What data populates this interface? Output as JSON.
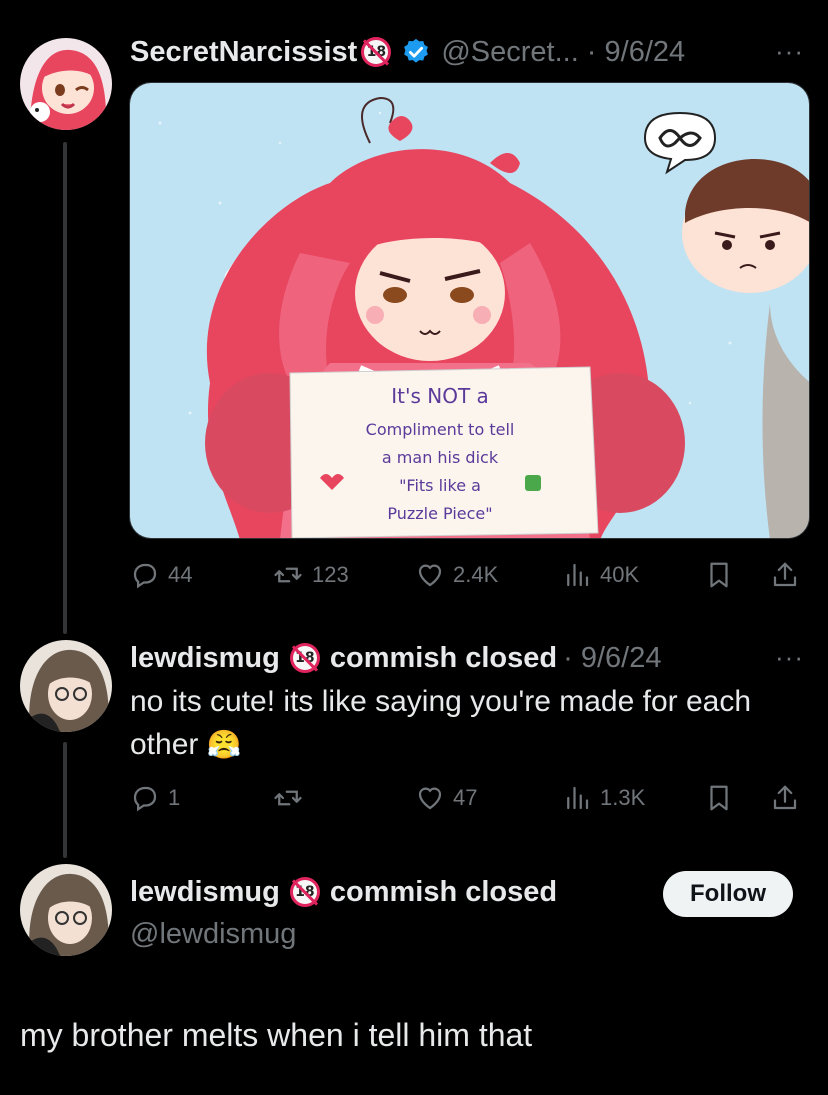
{
  "colors": {
    "background": "#000000",
    "text": "#e7e9ea",
    "muted": "#71767b",
    "verified": "#1d9bf0",
    "nsfw_badge": "#e0245e"
  },
  "tweet1": {
    "display_name": "SecretNarcissist",
    "handle_date": "@Secret... · 9/6/24",
    "more": "···",
    "image": {
      "sign_lines": [
        "It's NOT a",
        "Compliment to tell",
        "a man his dick",
        "\"Fits like a",
        "Puzzle Piece\""
      ]
    },
    "stats": {
      "replies": "44",
      "reposts": "123",
      "likes": "2.4K",
      "views": "40K"
    }
  },
  "reply": {
    "display_name": "lewdismug",
    "bio_tag": "commish closed",
    "date": "· 9/6/24",
    "more": "···",
    "text_line1": "no its cute! its like saying you're made for each",
    "text_line2": "other",
    "emoji": "😤",
    "stats": {
      "replies": "1",
      "reposts": "",
      "likes": "47",
      "views": "1.3K"
    }
  },
  "main": {
    "display_name": "lewdismug",
    "bio_tag": "commish closed",
    "handle": "@lewdismug",
    "follow_label": "Follow",
    "text": "my brother melts when i tell him that"
  },
  "icons": [
    "reply-icon",
    "repost-icon",
    "like-icon",
    "views-icon",
    "bookmark-icon",
    "share-icon",
    "verified-icon",
    "nsfw-badge-icon"
  ]
}
